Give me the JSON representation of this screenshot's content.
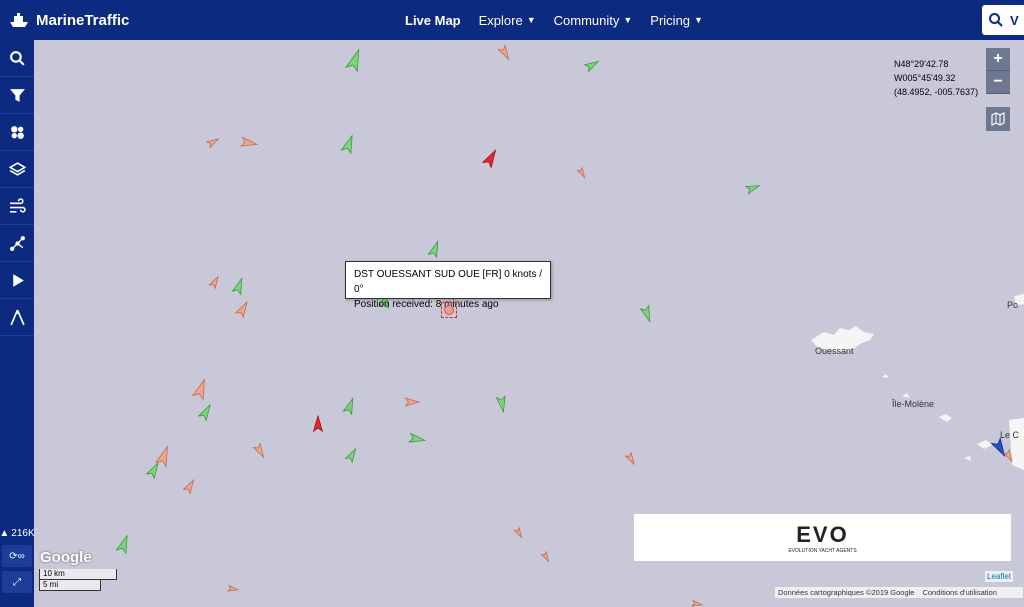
{
  "header": {
    "brand": "MarineTraffic",
    "nav": [
      {
        "label": "Live Map",
        "active": true,
        "dropdown": false
      },
      {
        "label": "Explore",
        "active": false,
        "dropdown": true
      },
      {
        "label": "Community",
        "active": false,
        "dropdown": true
      },
      {
        "label": "Pricing",
        "active": false,
        "dropdown": true
      }
    ],
    "search_peek": "V"
  },
  "sidebar": {
    "items": [
      "search-icon",
      "filter-icon",
      "density-icon",
      "layers-icon",
      "wind-icon",
      "route-icon",
      "play-icon",
      "measure-icon"
    ],
    "ship_count": "216K",
    "track_label": "∞"
  },
  "map": {
    "coordinates": {
      "line1": "N48°29'42.78",
      "line2": "W005°45'49.32",
      "line3": "(48.4952, -005.7637)"
    },
    "zoom_in": "+",
    "zoom_out": "−",
    "tooltip": {
      "line1": "DST OUESSANT SUD OUE [FR] 0 knots / 0°",
      "line2": "Position received: 8 minutes ago"
    },
    "places": {
      "ouessant": "Ouessant",
      "ile_molene": "Île-Molène",
      "le_c": "Le C",
      "po": "Po"
    },
    "ad": {
      "logo": "EVO",
      "tagline": "EVOLUTION YACHT AGENTS"
    },
    "google_logo": "Google",
    "scale_km": "10 km",
    "scale_mi": "5 mi",
    "attribution": "Données cartographiques ©2019 Google",
    "terms": "Conditions d'utilisation",
    "leaflet": "Leaflet",
    "colors": {
      "cargo": "#7fd27f",
      "tanker": "#f0a58f",
      "highlight": "#e8262e",
      "passenger": "#2050d0"
    }
  }
}
